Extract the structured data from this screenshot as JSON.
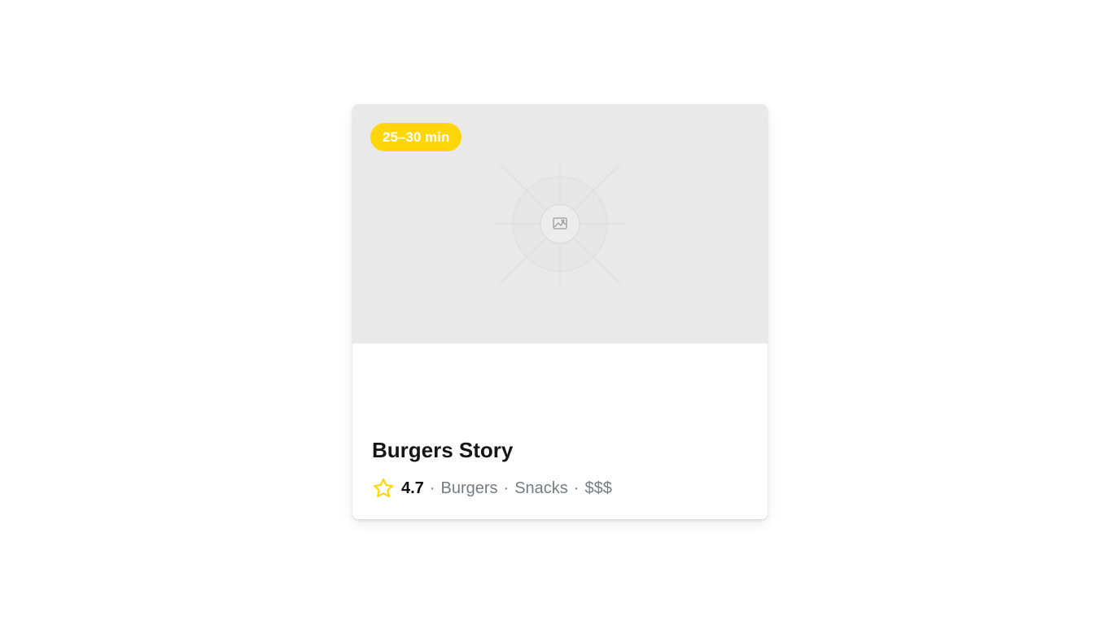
{
  "card": {
    "delivery_time": "25–30 min",
    "name": "Burgers Story",
    "rating": "4.7",
    "separator": "·",
    "categories": [
      "Burgers",
      "Snacks"
    ],
    "price_level": "$$$",
    "image_icon": "image-placeholder-icon",
    "rating_icon": "star-icon"
  },
  "colors": {
    "badge_bg": "#ffd60a",
    "star": "#ffd60a",
    "image_bg": "#e9e9e9",
    "secondary_text": "#777b82"
  }
}
